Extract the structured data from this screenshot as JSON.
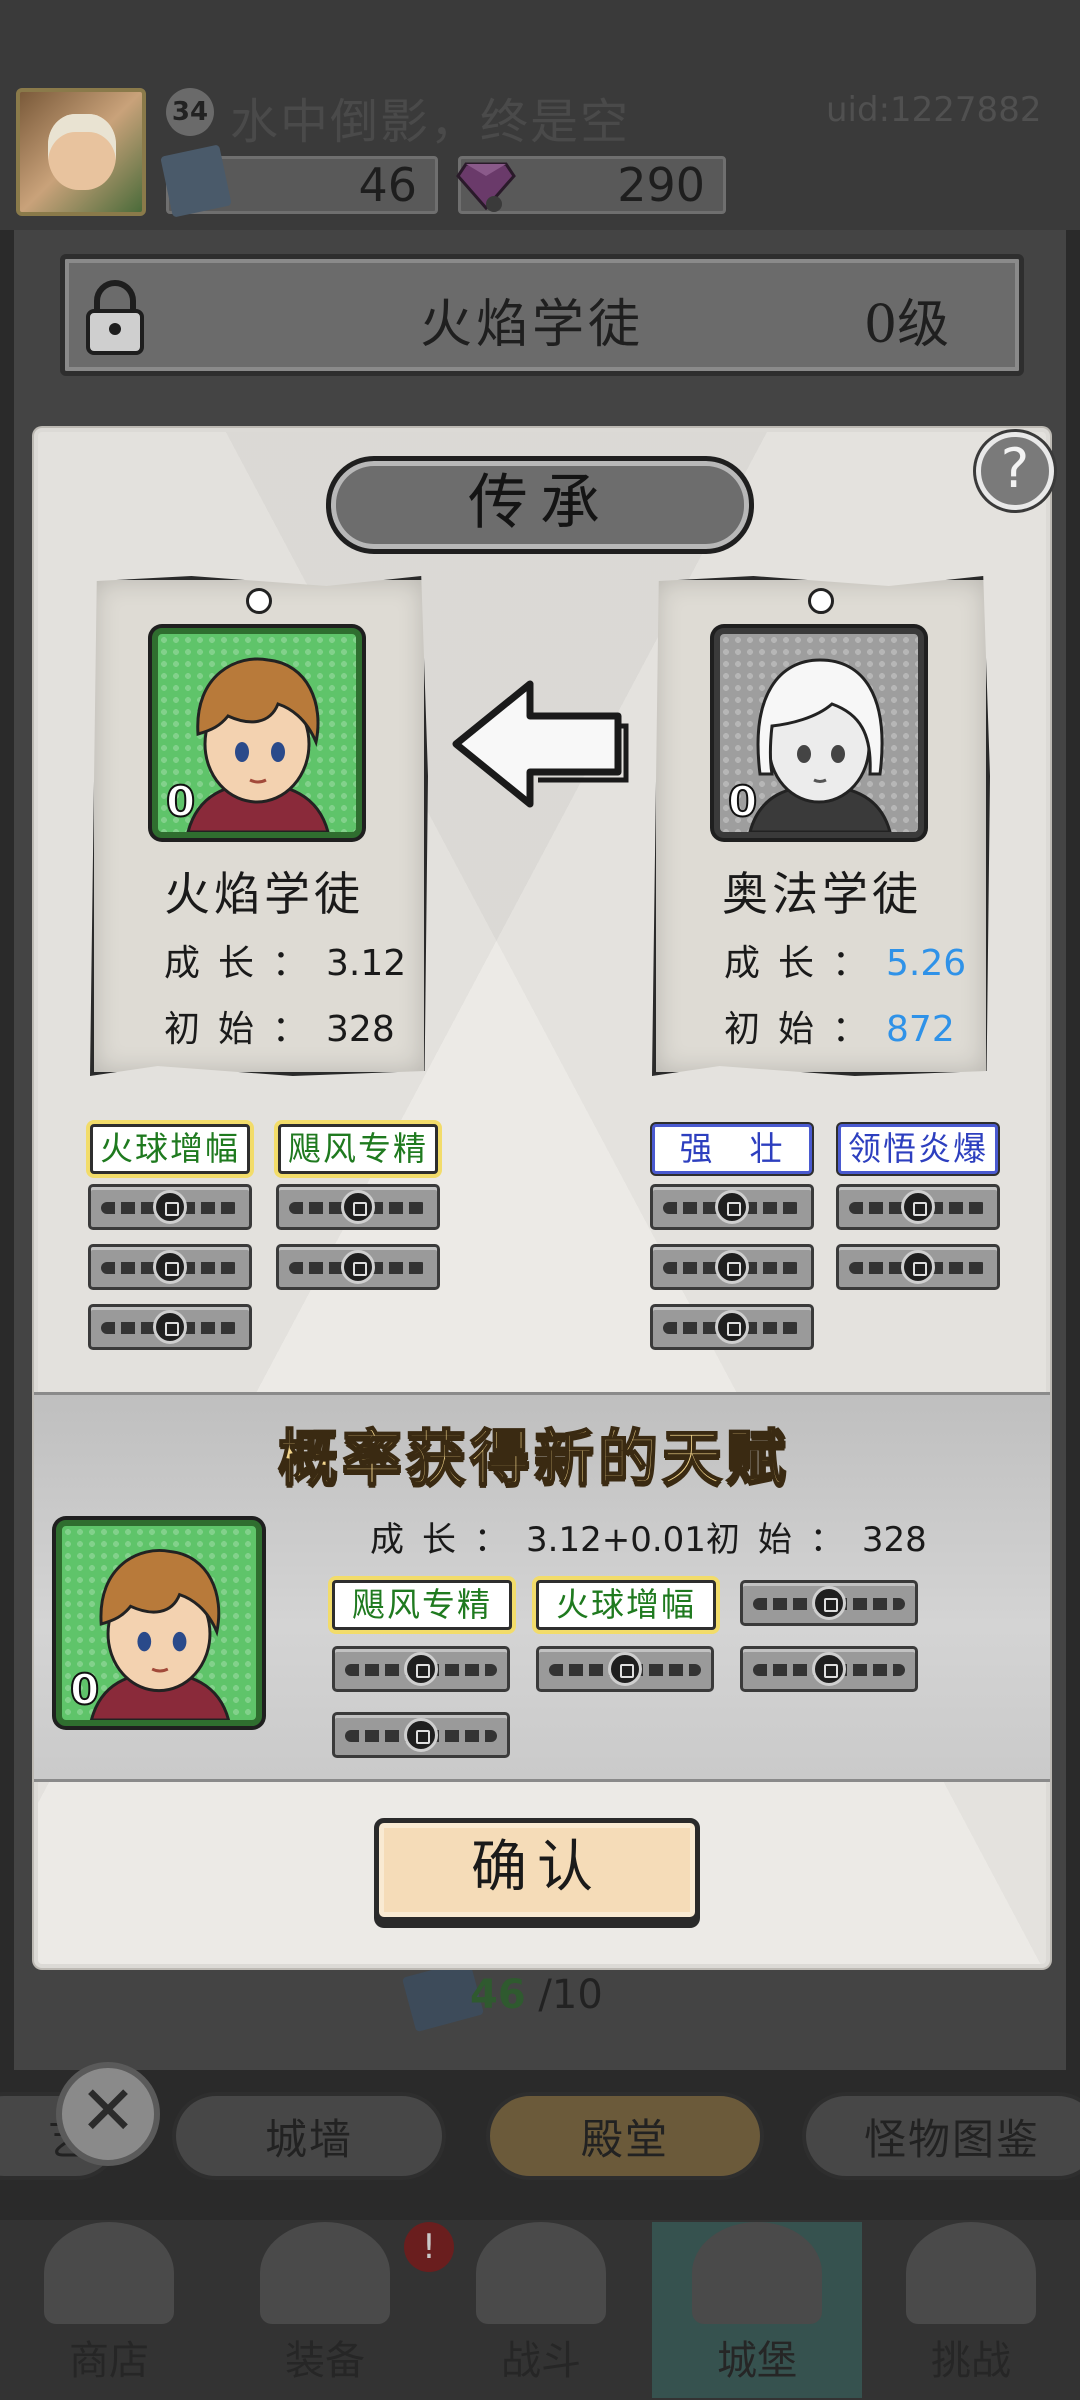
{
  "player": {
    "level": "34",
    "name": "水中倒影，终是空",
    "uid": "uid:1227882",
    "books": "46",
    "gems": "290"
  },
  "hero_plate": {
    "title": "火焰学徒",
    "level": "0级"
  },
  "modal": {
    "title": "传承",
    "help": "?",
    "source": {
      "level": "0",
      "name": "火焰学徒",
      "growth_label": "成长：",
      "growth": "3.12",
      "initial_label": "初始：",
      "initial": "328",
      "talents": [
        "火球增幅",
        "飓风专精"
      ]
    },
    "target": {
      "level": "0",
      "name": "奥法学徒",
      "growth_label": "成长：",
      "growth": "5.26",
      "initial_label": "初始：",
      "initial": "872",
      "talents": [
        "强　壮",
        "领悟炎爆"
      ]
    },
    "result": {
      "title": "概率获得新的天赋",
      "level": "0",
      "growth_label": "成长：",
      "growth": "3.12+0.01",
      "initial_label": "初始：",
      "initial": "328",
      "talents": [
        "飓风专精",
        "火球增幅"
      ]
    },
    "confirm": "确认"
  },
  "bottom_counter": {
    "current": "46",
    "total": "/10"
  },
  "tabs": [
    "城墙",
    "殿堂",
    "怪物图鉴"
  ],
  "tab_left_fragment": "艺",
  "nav": {
    "items": [
      "商店",
      "装备",
      "战斗",
      "城堡",
      "挑战"
    ],
    "notify": "!"
  },
  "colors": {
    "talent_green": "#1f7a1f",
    "talent_blue": "#2d3fbf",
    "stat_blue": "#2f92e8",
    "confirm_bg": "#f5dcb8"
  }
}
